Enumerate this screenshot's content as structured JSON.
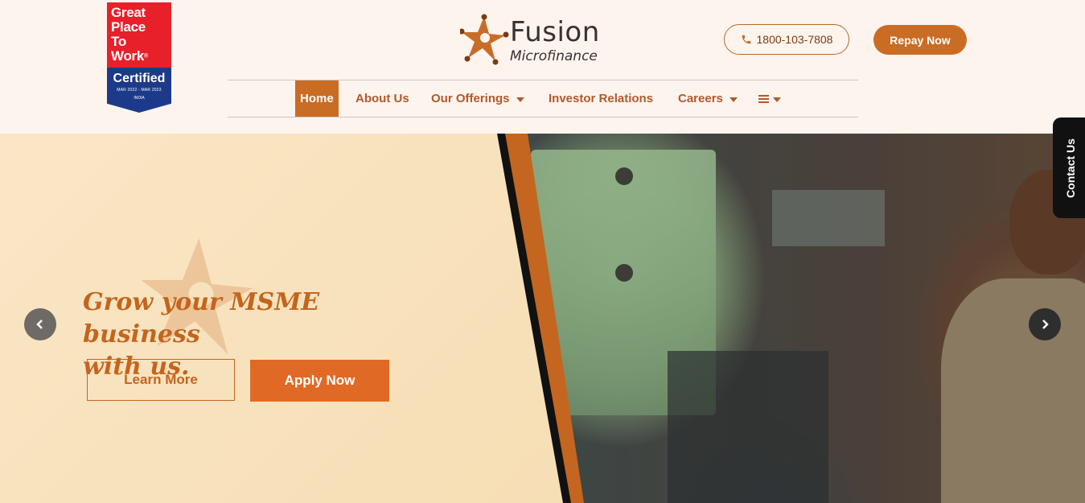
{
  "badge": {
    "lines": [
      "Great",
      "Place",
      "To",
      "Work"
    ],
    "registered": "®",
    "certified": "Certified",
    "period": "MAR 2022 - MAR 2023",
    "country": "INDIA"
  },
  "logo": {
    "name": "Fusion",
    "sub": "Microfinance"
  },
  "header": {
    "phone": "1800-103-7808",
    "repay_label": "Repay Now"
  },
  "nav": {
    "items": [
      {
        "label": "Home"
      },
      {
        "label": "About Us"
      },
      {
        "label": "Our Offerings"
      },
      {
        "label": "Investor Relations"
      },
      {
        "label": "Careers"
      }
    ]
  },
  "hero": {
    "headline_line1": "Grow your MSME business",
    "headline_line2": "with us.",
    "learn_more": "Learn More",
    "apply_now": "Apply Now"
  },
  "contact_tab": "Contact Us",
  "colors": {
    "brand_orange": "#c96c24",
    "apply_orange": "#e06a25",
    "nav_text": "#b2592b",
    "badge_red": "#e8202a",
    "badge_blue": "#1d3a8a"
  },
  "icons": [
    "phone-icon",
    "chevron-left-icon",
    "chevron-right-icon",
    "hamburger-icon",
    "caret-down-icon",
    "fusion-star-logo"
  ]
}
